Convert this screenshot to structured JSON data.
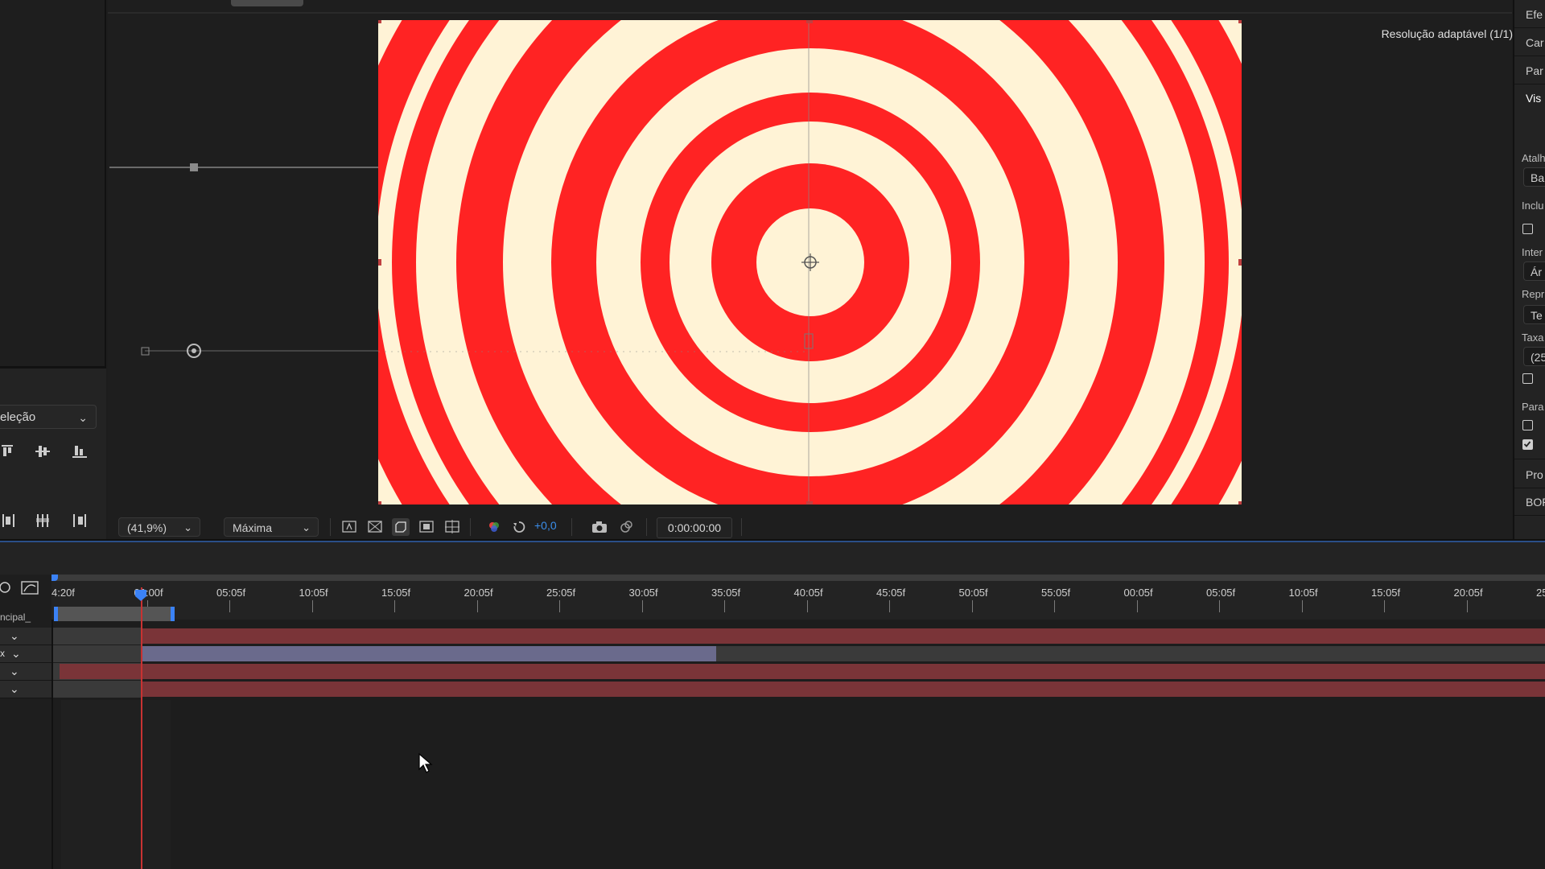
{
  "viewer": {
    "resolution_label": "Resolução adaptável (1/1)",
    "zoom": "(41,9%)",
    "quality": "Máxima",
    "exposure": "+0,0",
    "timecode": "0:00:00:00"
  },
  "left_panel": {
    "align_select": "eleção"
  },
  "right_panel": {
    "tabs": [
      "Efe",
      "Car",
      "Par",
      "Vis"
    ],
    "labels": [
      "Atalh",
      "Inclu",
      "Inter",
      "Repr",
      "Taxa",
      "Para",
      "Pro",
      "BOR"
    ],
    "fields": [
      "Ba",
      "Ár",
      "Te",
      "(25"
    ]
  },
  "timeline": {
    "ruler_ticks": [
      "4:20f",
      "00:00f",
      "05:05f",
      "10:05f",
      "15:05f",
      "20:05f",
      "25:05f",
      "30:05f",
      "35:05f",
      "40:05f",
      "45:05f",
      "50:05f",
      "55:05f",
      "00:05f",
      "05:05f",
      "10:05f",
      "15:05f",
      "20:05f",
      "25:"
    ],
    "comp_label": "ncipal_",
    "layer_count": 4
  },
  "colors": {
    "target_red": "#ff2323",
    "target_cream": "#fff3d6",
    "accent_blue": "#3b82f6",
    "layer_red": "#7a3438",
    "layer_lavender": "#6a6a8c",
    "cti_red": "#c83232"
  }
}
